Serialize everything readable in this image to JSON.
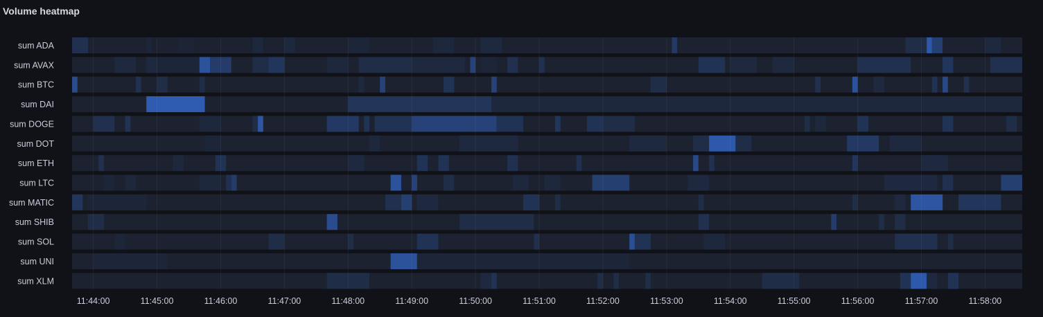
{
  "panel": {
    "title": "Volume heatmap"
  },
  "chart_data": {
    "type": "heatmap",
    "title": "Volume heatmap",
    "rows": [
      "sum ADA",
      "sum AVAX",
      "sum BTC",
      "sum DAI",
      "sum DOGE",
      "sum DOT",
      "sum ETH",
      "sum LTC",
      "sum MATIC",
      "sum SHIB",
      "sum SOL",
      "sum UNI",
      "sum XLM"
    ],
    "x_ticks": [
      "11:44:00",
      "11:45:00",
      "11:46:00",
      "11:47:00",
      "11:48:00",
      "11:49:00",
      "11:50:00",
      "11:51:00",
      "11:52:00",
      "11:53:00",
      "11:54:00",
      "11:55:00",
      "11:56:00",
      "11:57:00",
      "11:58:00"
    ],
    "x_range": [
      "11:43:40",
      "11:58:35"
    ],
    "grid": true,
    "legend": "none",
    "color_scale": {
      "low": "#1a1d24",
      "high": "#2f5bb0"
    },
    "background_intensity": 0.08,
    "segments": [
      [
        [
          "11:43:40",
          "11:43:55",
          0.3
        ],
        [
          "11:44:50",
          "11:44:55",
          0.15
        ],
        [
          "11:45:20",
          "11:45:35",
          0.12
        ],
        [
          "11:46:30",
          "11:46:40",
          0.18
        ],
        [
          "11:47:00",
          "11:47:10",
          0.18
        ],
        [
          "11:48:00",
          "11:48:20",
          0.15
        ],
        [
          "11:49:20",
          "11:49:40",
          0.18
        ],
        [
          "11:50:05",
          "11:50:25",
          0.2
        ],
        [
          "11:53:05",
          "11:53:10",
          0.45
        ],
        [
          "11:57:05",
          "11:57:10",
          0.95
        ],
        [
          "11:57:10",
          "11:57:20",
          0.55
        ],
        [
          "11:56:45",
          "11:57:05",
          0.25
        ],
        [
          "11:58:00",
          "11:58:15",
          0.2
        ]
      ],
      [
        [
          "11:44:20",
          "11:44:40",
          0.2
        ],
        [
          "11:44:50",
          "11:45:00",
          0.2
        ],
        [
          "11:45:00",
          "11:45:40",
          0.15
        ],
        [
          "11:45:40",
          "11:45:50",
          0.85
        ],
        [
          "11:45:50",
          "11:46:10",
          0.5
        ],
        [
          "11:46:30",
          "11:46:45",
          0.25
        ],
        [
          "11:46:45",
          "11:47:00",
          0.4
        ],
        [
          "11:47:40",
          "11:48:00",
          0.18
        ],
        [
          "11:48:10",
          "11:49:00",
          0.25
        ],
        [
          "11:49:00",
          "11:49:50",
          0.2
        ],
        [
          "11:49:55",
          "11:50:00",
          0.6
        ],
        [
          "11:50:05",
          "11:50:20",
          0.15
        ],
        [
          "11:50:30",
          "11:50:40",
          0.3
        ],
        [
          "11:51:00",
          "11:51:05",
          0.3
        ],
        [
          "11:53:30",
          "11:53:55",
          0.35
        ],
        [
          "11:54:00",
          "11:54:25",
          0.2
        ],
        [
          "11:54:40",
          "11:55:00",
          0.2
        ],
        [
          "11:56:00",
          "11:56:50",
          0.3
        ],
        [
          "11:57:20",
          "11:57:30",
          0.4
        ],
        [
          "11:58:05",
          "11:58:35",
          0.3
        ]
      ],
      [
        [
          "11:43:40",
          "11:43:45",
          0.75
        ],
        [
          "11:44:40",
          "11:44:45",
          0.3
        ],
        [
          "11:45:00",
          "11:45:10",
          0.25
        ],
        [
          "11:45:40",
          "11:45:45",
          0.25
        ],
        [
          "11:48:10",
          "11:48:15",
          0.2
        ],
        [
          "11:48:30",
          "11:48:35",
          0.6
        ],
        [
          "11:49:30",
          "11:49:40",
          0.35
        ],
        [
          "11:50:15",
          "11:50:20",
          0.6
        ],
        [
          "11:52:45",
          "11:53:00",
          0.25
        ],
        [
          "11:55:20",
          "11:55:25",
          0.3
        ],
        [
          "11:55:55",
          "11:56:00",
          0.85
        ],
        [
          "11:56:15",
          "11:56:25",
          0.2
        ],
        [
          "11:57:10",
          "11:57:15",
          0.35
        ],
        [
          "11:57:20",
          "11:57:25",
          0.7
        ],
        [
          "11:57:40",
          "11:57:45",
          0.3
        ]
      ],
      [
        [
          "11:44:50",
          "11:45:45",
          1.0
        ],
        [
          "11:48:00",
          "11:50:15",
          0.38
        ],
        [
          "11:50:15",
          "11:58:35",
          0.18
        ]
      ],
      [
        [
          "11:44:00",
          "11:44:20",
          0.3
        ],
        [
          "11:44:30",
          "11:44:35",
          0.35
        ],
        [
          "11:45:40",
          "11:46:00",
          0.18
        ],
        [
          "11:46:30",
          "11:46:35",
          0.25
        ],
        [
          "11:46:35",
          "11:46:40",
          0.9
        ],
        [
          "11:47:40",
          "11:48:10",
          0.45
        ],
        [
          "11:48:15",
          "11:48:20",
          0.35
        ],
        [
          "11:48:25",
          "11:49:00",
          0.35
        ],
        [
          "11:49:00",
          "11:50:20",
          0.6
        ],
        [
          "11:50:20",
          "11:50:45",
          0.35
        ],
        [
          "11:51:15",
          "11:51:20",
          0.4
        ],
        [
          "11:51:45",
          "11:52:00",
          0.35
        ],
        [
          "11:52:00",
          "11:52:30",
          0.25
        ],
        [
          "11:55:10",
          "11:55:15",
          0.25
        ],
        [
          "11:55:20",
          "11:55:30",
          0.18
        ],
        [
          "11:56:00",
          "11:56:10",
          0.35
        ],
        [
          "11:57:20",
          "11:57:30",
          0.35
        ],
        [
          "11:58:20",
          "11:58:30",
          0.25
        ]
      ],
      [
        [
          "11:45:45",
          "11:46:00",
          0.15
        ],
        [
          "11:48:20",
          "11:48:30",
          0.18
        ],
        [
          "11:49:45",
          "11:50:40",
          0.2
        ],
        [
          "11:52:25",
          "11:53:00",
          0.2
        ],
        [
          "11:53:25",
          "11:53:40",
          0.25
        ],
        [
          "11:53:40",
          "11:54:05",
          0.95
        ],
        [
          "11:54:05",
          "11:54:20",
          0.25
        ],
        [
          "11:55:50",
          "11:56:20",
          0.45
        ],
        [
          "11:56:30",
          "11:57:00",
          0.2
        ]
      ],
      [
        [
          "11:44:05",
          "11:44:10",
          0.3
        ],
        [
          "11:45:15",
          "11:45:25",
          0.18
        ],
        [
          "11:45:55",
          "11:46:05",
          0.35
        ],
        [
          "11:48:00",
          "11:48:15",
          0.2
        ],
        [
          "11:49:05",
          "11:49:15",
          0.35
        ],
        [
          "11:49:25",
          "11:49:35",
          0.35
        ],
        [
          "11:50:30",
          "11:50:40",
          0.3
        ],
        [
          "11:51:35",
          "11:51:40",
          0.3
        ],
        [
          "11:53:25",
          "11:53:30",
          0.7
        ],
        [
          "11:53:40",
          "11:53:45",
          0.3
        ],
        [
          "11:55:55",
          "11:56:00",
          0.4
        ],
        [
          "11:57:00",
          "11:57:25",
          0.2
        ]
      ],
      [
        [
          "11:44:10",
          "11:44:20",
          0.15
        ],
        [
          "11:44:30",
          "11:44:40",
          0.18
        ],
        [
          "11:45:40",
          "11:46:00",
          0.18
        ],
        [
          "11:46:05",
          "11:46:10",
          0.3
        ],
        [
          "11:46:10",
          "11:46:15",
          0.5
        ],
        [
          "11:48:40",
          "11:48:50",
          0.85
        ],
        [
          "11:49:00",
          "11:49:05",
          0.6
        ],
        [
          "11:49:30",
          "11:49:40",
          0.25
        ],
        [
          "11:50:35",
          "11:50:50",
          0.18
        ],
        [
          "11:51:05",
          "11:51:20",
          0.18
        ],
        [
          "11:51:50",
          "11:52:25",
          0.55
        ],
        [
          "11:53:20",
          "11:53:40",
          0.2
        ],
        [
          "11:56:25",
          "11:57:15",
          0.2
        ],
        [
          "11:57:20",
          "11:57:30",
          0.3
        ],
        [
          "11:58:15",
          "11:58:35",
          0.55
        ]
      ],
      [
        [
          "11:43:40",
          "11:43:50",
          0.4
        ],
        [
          "11:43:55",
          "11:44:50",
          0.15
        ],
        [
          "11:48:35",
          "11:48:50",
          0.3
        ],
        [
          "11:48:50",
          "11:49:00",
          0.55
        ],
        [
          "11:49:05",
          "11:49:25",
          0.2
        ],
        [
          "11:50:45",
          "11:51:00",
          0.35
        ],
        [
          "11:51:15",
          "11:51:20",
          0.25
        ],
        [
          "11:53:30",
          "11:53:35",
          0.25
        ],
        [
          "11:55:55",
          "11:56:00",
          0.25
        ],
        [
          "11:56:35",
          "11:56:45",
          0.2
        ],
        [
          "11:56:50",
          "11:57:20",
          0.9
        ],
        [
          "11:57:35",
          "11:58:15",
          0.4
        ]
      ],
      [
        [
          "11:43:55",
          "11:44:10",
          0.25
        ],
        [
          "11:47:40",
          "11:47:50",
          0.75
        ],
        [
          "11:49:45",
          "11:50:55",
          0.25
        ],
        [
          "11:53:30",
          "11:53:40",
          0.3
        ],
        [
          "11:55:35",
          "11:55:40",
          0.5
        ],
        [
          "11:56:20",
          "11:56:25",
          0.25
        ],
        [
          "11:56:35",
          "11:56:45",
          0.25
        ]
      ],
      [
        [
          "11:44:20",
          "11:44:30",
          0.15
        ],
        [
          "11:46:45",
          "11:47:00",
          0.25
        ],
        [
          "11:48:00",
          "11:48:05",
          0.25
        ],
        [
          "11:49:05",
          "11:49:25",
          0.35
        ],
        [
          "11:50:55",
          "11:51:00",
          0.3
        ],
        [
          "11:52:25",
          "11:52:30",
          0.8
        ],
        [
          "11:52:30",
          "11:52:45",
          0.35
        ],
        [
          "11:53:35",
          "11:53:55",
          0.18
        ],
        [
          "11:56:35",
          "11:57:15",
          0.3
        ],
        [
          "11:57:25",
          "11:57:30",
          0.25
        ]
      ],
      [
        [
          "11:44:00",
          "11:45:10",
          0.15
        ],
        [
          "11:48:40",
          "11:49:05",
          0.85
        ],
        [
          "11:49:05",
          "11:52:25",
          0.15
        ]
      ],
      [
        [
          "11:47:40",
          "11:48:20",
          0.25
        ],
        [
          "11:50:05",
          "11:50:15",
          0.2
        ],
        [
          "11:50:15",
          "11:50:20",
          0.35
        ],
        [
          "11:51:55",
          "11:52:00",
          0.25
        ],
        [
          "11:52:10",
          "11:52:15",
          0.25
        ],
        [
          "11:52:40",
          "11:52:45",
          0.25
        ],
        [
          "11:54:30",
          "11:55:05",
          0.25
        ],
        [
          "11:56:40",
          "11:56:50",
          0.35
        ],
        [
          "11:56:50",
          "11:57:05",
          0.95
        ],
        [
          "11:57:05",
          "11:57:15",
          0.2
        ],
        [
          "11:57:25",
          "11:57:35",
          0.35
        ]
      ]
    ]
  }
}
